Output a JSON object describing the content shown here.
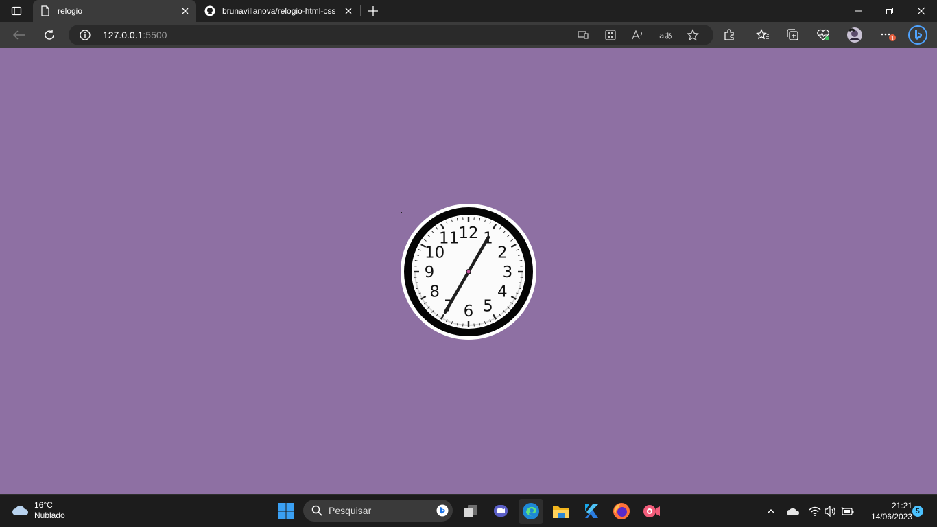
{
  "browser": {
    "tabs": [
      {
        "title": "relogio",
        "active": true,
        "favicon": "page-icon"
      },
      {
        "title": "brunavillanova/relogio-html-css",
        "active": false,
        "favicon": "github-icon"
      }
    ],
    "url_host": "127.0.0.1",
    "url_port": ":5500"
  },
  "page": {
    "background": "#8e70a3",
    "clock": {
      "numbers": [
        "12",
        "1",
        "2",
        "3",
        "4",
        "5",
        "6",
        "7",
        "8",
        "9",
        "10",
        "11"
      ],
      "hand_angle_deg": 30,
      "ring_color": "#000000",
      "center_color": "#c0509a"
    }
  },
  "taskbar": {
    "weather_temp": "16°C",
    "weather_desc": "Nublado",
    "search_placeholder": "Pesquisar",
    "time": "21:21",
    "date": "14/06/2023",
    "notification_count": "5",
    "battery_badge": "1"
  }
}
